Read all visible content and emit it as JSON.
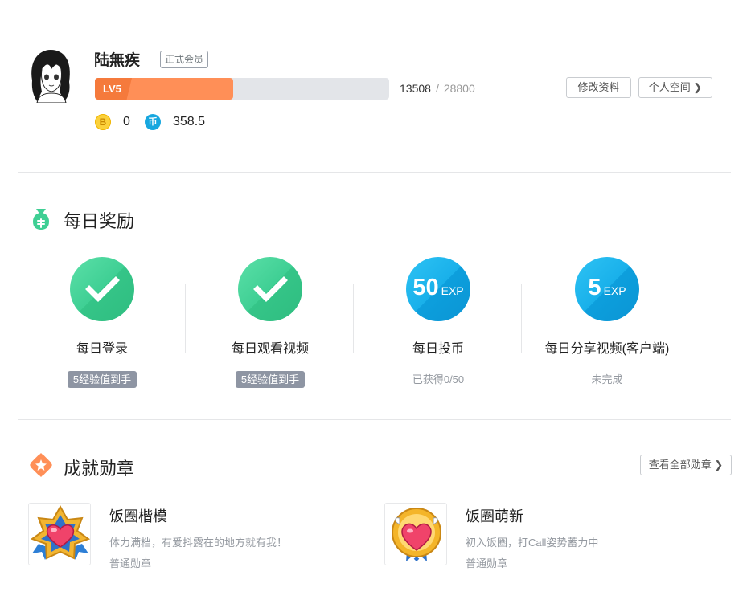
{
  "profile": {
    "username": "陆無疾",
    "member_tag": "正式会员",
    "level_label": "LV5",
    "exp_current": "13508",
    "exp_separator": "/",
    "exp_max": "28800",
    "exp_progress": 0.469,
    "edit_button": "修改资料",
    "space_button": "个人空间 ❯",
    "coins": [
      {
        "icon": "b-coin-icon",
        "symbol": "B",
        "value": "0"
      },
      {
        "icon": "hard-coin-icon",
        "symbol": "币",
        "value": "358.5"
      }
    ]
  },
  "daily": {
    "title": "每日奖励",
    "tasks": [
      {
        "name": "每日登录",
        "state": "done",
        "status": "5经验值到手"
      },
      {
        "name": "每日观看视频",
        "state": "done",
        "status": "5经验值到手"
      },
      {
        "name": "每日投币",
        "state": "pending",
        "exp_amount": "50",
        "exp_unit": "EXP",
        "status": "已获得0/50"
      },
      {
        "name": "每日分享视频(客户端)",
        "state": "pending",
        "exp_amount": "5",
        "exp_unit": "EXP",
        "status": "未完成"
      }
    ]
  },
  "medals": {
    "title": "成就勋章",
    "view_all": "查看全部勋章 ❯",
    "items": [
      {
        "name": "饭圈楷模",
        "desc": "体力满档，有爱抖露在的地方就有我！",
        "type": "普通勋章"
      },
      {
        "name": "饭圈萌新",
        "desc": "初入饭圈，打Call姿势蓄力中",
        "type": "普通勋章"
      }
    ]
  },
  "colors": {
    "level_fill": "#ff8f57",
    "level_badge": "#f57a3c",
    "done_green": "#3fcf94",
    "exp_blue": "#19b0ea",
    "chip_gray": "#8e95a3",
    "section_icon_green": "#3fcf94",
    "section_icon_orange": "#ff8f57"
  }
}
